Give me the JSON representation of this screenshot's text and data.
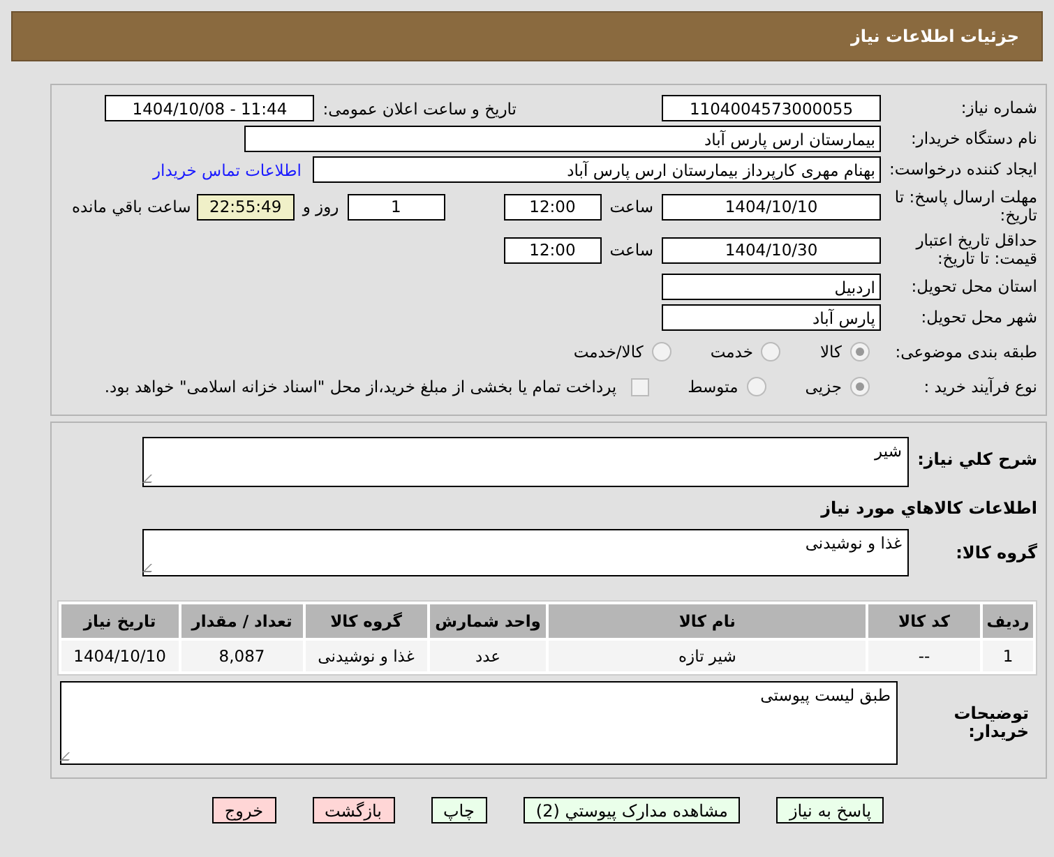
{
  "header": {
    "title": "جزئیات اطلاعات نیاز"
  },
  "need_number": {
    "label": "شماره نیاز:",
    "value": "1104004573000055"
  },
  "announce": {
    "label": "تاریخ و ساعت اعلان عمومی:",
    "value": "1404/10/08 - 11:44"
  },
  "buyer_org": {
    "label": "نام دستگاه خریدار:",
    "value": "بیمارستان ارس پارس آباد"
  },
  "creator": {
    "label": "ایجاد کننده درخواست:",
    "value": "بهنام  مهری کارپرداز بیمارستان ارس پارس آباد",
    "link": "اطلاعات تماس خریدار"
  },
  "deadline": {
    "label": "مهلت ارسال پاسخ: تا تاریخ:",
    "date": "1404/10/10",
    "time_label": "ساعت",
    "time": "12:00",
    "days": "1",
    "days_label": "روز و",
    "remaining": "22:55:49",
    "remaining_label": "ساعت باقي مانده"
  },
  "validity": {
    "label": "حداقل تاریخ اعتبار قیمت: تا تاریخ:",
    "date": "1404/10/30",
    "time_label": "ساعت",
    "time": "12:00"
  },
  "province": {
    "label": "استان محل تحویل:",
    "value": "اردبیل"
  },
  "city": {
    "label": "شهر محل تحویل:",
    "value": "پارس آباد"
  },
  "category": {
    "label": "طبقه بندی موضوعی:",
    "options": [
      {
        "label": "کالا",
        "selected": true
      },
      {
        "label": "خدمت",
        "selected": false
      },
      {
        "label": "کالا/خدمت",
        "selected": false
      }
    ]
  },
  "process": {
    "label": "نوع فرآیند خرید :",
    "options": [
      {
        "label": "جزیی",
        "selected": true
      },
      {
        "label": "متوسط",
        "selected": false
      }
    ],
    "treasury": {
      "checked": false,
      "label": "پرداخت تمام یا بخشی از مبلغ خرید،از محل \"اسناد خزانه اسلامی\" خواهد بود."
    }
  },
  "description": {
    "label": "شرح کلي نیاز:",
    "value": "شیر"
  },
  "goods_title": "اطلاعات کالاهاي مورد نیاز",
  "goods_group": {
    "label": "گروه کالا:",
    "value": "غذا و نوشیدنی"
  },
  "table": {
    "columns": [
      "ردیف",
      "کد کالا",
      "نام کالا",
      "واحد شمارش",
      "گروه کالا",
      "تعداد / مقدار",
      "تاریخ نیاز"
    ],
    "rows": [
      [
        "1",
        "--",
        "شیر تازه",
        "عدد",
        "غذا و نوشیدنی",
        "8,087",
        "1404/10/10"
      ]
    ]
  },
  "buyer_notes": {
    "label": "توضیحات خریدار:",
    "value": "طبق لیست پیوستی"
  },
  "buttons": [
    {
      "label": "پاسخ به نیاز",
      "kind": "action"
    },
    {
      "label": "مشاهده مدارک پیوستي (2)",
      "kind": "action"
    },
    {
      "label": "چاپ",
      "kind": "action"
    },
    {
      "label": "بازگشت",
      "kind": "exit"
    },
    {
      "label": "خروج",
      "kind": "exit"
    }
  ]
}
